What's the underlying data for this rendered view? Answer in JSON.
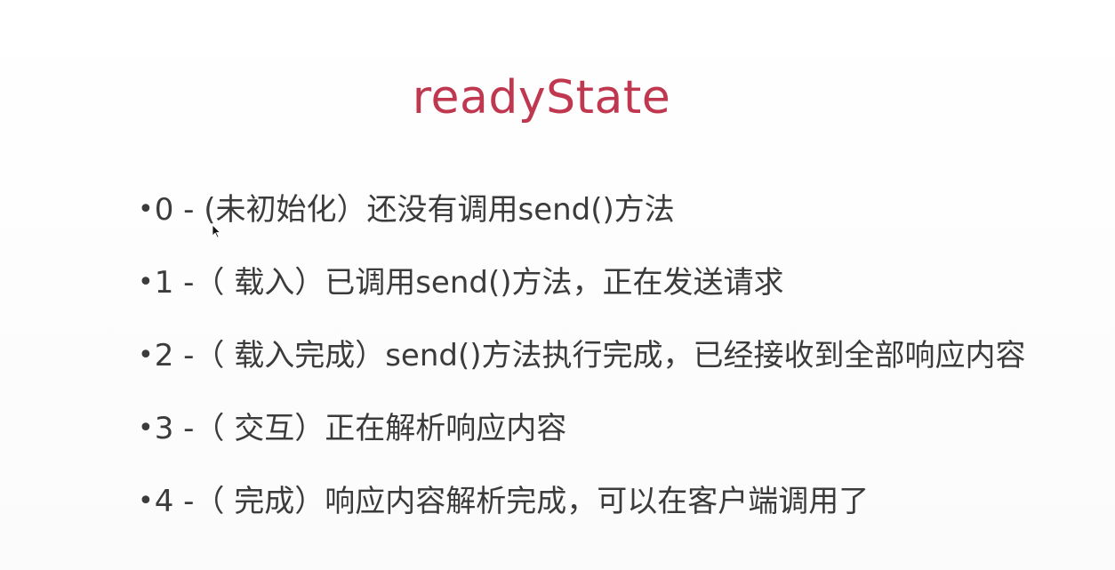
{
  "slide": {
    "title": "readyState",
    "bullet_symbol": "•",
    "items": [
      {
        "text": "0 - (未初始化）还没有调用send()方法"
      },
      {
        "text": "1 -（ 载入）已调用send()方法，正在发送请求"
      },
      {
        "text": "2 -（ 载入完成）send()方法执行完成，已经接收到全部响应内容"
      },
      {
        "text": "3 -（ 交互）正在解析响应内容"
      },
      {
        "text": "4 -（ 完成）响应内容解析完成，可以在客户端调用了"
      }
    ]
  },
  "colors": {
    "title": "#c0384f",
    "body_text": "#3b3b3b",
    "background": "#fdfdfd"
  },
  "icons": {
    "cursor": "mouse-pointer-icon"
  }
}
